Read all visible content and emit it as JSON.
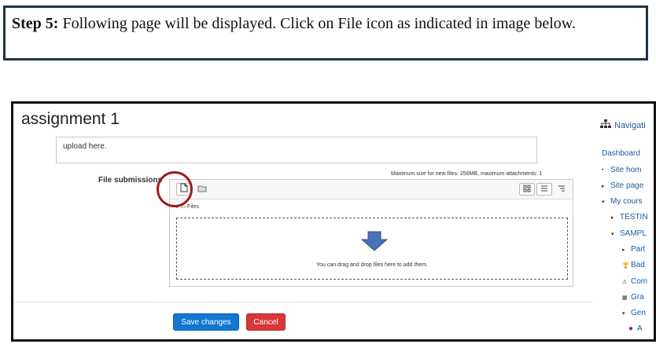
{
  "instruction": {
    "step_label": "Step 5:",
    "text": "Following page will be displayed. Click on File icon as indicated in image below."
  },
  "page": {
    "title": "assignment 1",
    "online_text_value": "upload here.",
    "file_submissions_label": "File submissions",
    "max_size_text": "Maximum size for new files: 256MB, maximum attachments: 1",
    "path_label": "Files",
    "drop_text": "You can drag and drop files here to add them.",
    "save_label": "Save changes",
    "cancel_label": "Cancel"
  },
  "nav": {
    "header": "Navigati",
    "items": [
      {
        "label": "Dashboard",
        "marker": ""
      },
      {
        "label": "Site hom",
        "marker": "•"
      },
      {
        "label": "Site page",
        "marker": "▸"
      },
      {
        "label": "My cours",
        "marker": "▾"
      },
      {
        "label": "TESTIN",
        "marker": "▸"
      },
      {
        "label": "SAMPL",
        "marker": "▾"
      },
      {
        "label": "Part",
        "marker": "▸"
      },
      {
        "label": "Bad",
        "marker": "🏆"
      },
      {
        "label": "Com",
        "marker": "⚠"
      },
      {
        "label": "Gra",
        "marker": "▦"
      },
      {
        "label": "Gen",
        "marker": "▾"
      },
      {
        "label": "A",
        "marker": "●"
      }
    ]
  },
  "colors": {
    "highlight_circle": "#a11b1b",
    "save_button": "#1177d1",
    "cancel_button": "#d9383a",
    "dropzone_arrow": "#4a72b8",
    "link": "#1c5a9c"
  }
}
